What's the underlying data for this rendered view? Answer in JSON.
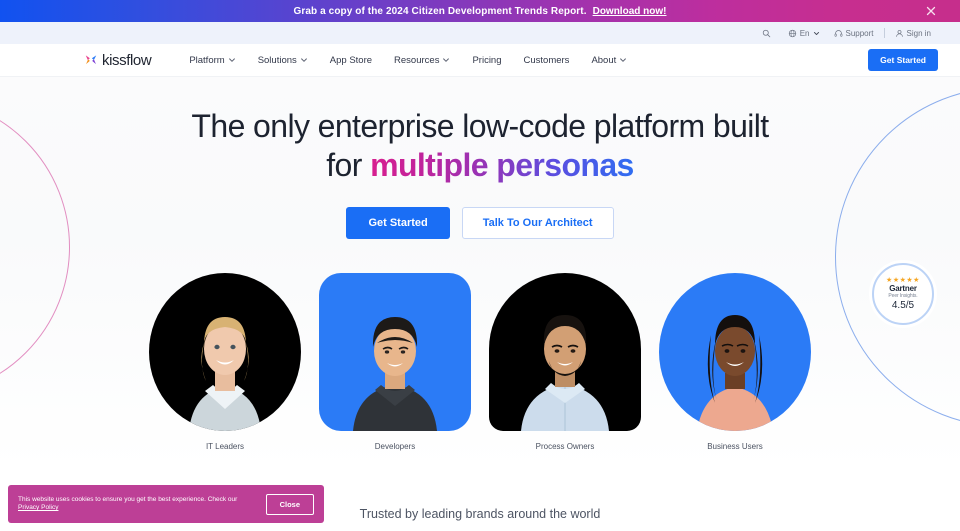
{
  "promo_banner": {
    "text": "Grab a copy of the 2024 Citizen Development Trends Report.",
    "link_label": "Download now!",
    "close_icon": "close-icon",
    "gradient_from": "#1152f0",
    "gradient_to": "#c62e8c"
  },
  "utility_bar": {
    "items": [
      {
        "label": "",
        "icon": "search-icon"
      },
      {
        "label": "En",
        "icon": "globe-icon",
        "chevron": "chevron-down-icon"
      },
      {
        "label": "Support",
        "icon": "headset-icon"
      },
      {
        "label": "Sign in",
        "icon": "user-icon"
      }
    ],
    "background": "#eef2fb"
  },
  "nav": {
    "logo_text": "kissflow",
    "links": [
      {
        "label": "Platform",
        "has_dropdown": true
      },
      {
        "label": "Solutions",
        "has_dropdown": true
      },
      {
        "label": "App Store",
        "has_dropdown": false
      },
      {
        "label": "Resources",
        "has_dropdown": true
      },
      {
        "label": "Pricing",
        "has_dropdown": false
      },
      {
        "label": "Customers",
        "has_dropdown": false
      },
      {
        "label": "About",
        "has_dropdown": true
      }
    ],
    "cta_label": "Get Started",
    "cta_color": "#1a6ef5"
  },
  "hero": {
    "headline_line1": "The only enterprise low-code platform built",
    "headline_line2_prefix": "for ",
    "headline_accent": "multiple personas",
    "accent_gradient_from": "#d81f8f",
    "accent_gradient_to": "#2f6df2",
    "primary_cta": "Get Started",
    "secondary_cta": "Talk To Our Architect"
  },
  "gartner_badge": {
    "stars": "★★★★★",
    "name": "Gartner",
    "subtitle": "Peer Insights.",
    "score": "4.5/5",
    "star_color": "#f5a623",
    "ring_color": "#bcd3f6"
  },
  "personas": [
    {
      "label": "IT Leaders",
      "shape": "circle",
      "background": "#000000",
      "skin": "#f0c9ad",
      "hair": "#d8b273",
      "clothes": "#ccd6db"
    },
    {
      "label": "Developers",
      "shape": "rounded-square",
      "background": "#2b7bf6",
      "skin": "#e8b68c",
      "hair": "#1d1a18",
      "clothes": "#2f3338"
    },
    {
      "label": "Process Owners",
      "shape": "arch",
      "background": "#000000",
      "skin": "#d29f74",
      "hair": "#17120f",
      "clothes": "#ccdcec"
    },
    {
      "label": "Business Users",
      "shape": "circle",
      "background": "#2b7bf6",
      "skin": "#7a4a2d",
      "hair": "#140f0d",
      "clothes": "#eda88f"
    }
  ],
  "trusted": {
    "text": "Trusted by leading brands around the world"
  },
  "cookie_banner": {
    "text": "This website uses cookies to ensure you get the best experience. Check our ",
    "link_label": "Privacy Policy",
    "close_label": "Close",
    "background": "#bd3f96"
  },
  "decor": {
    "arc_left_color": "#d96aae",
    "arc_right_color": "#6f9ae8"
  }
}
